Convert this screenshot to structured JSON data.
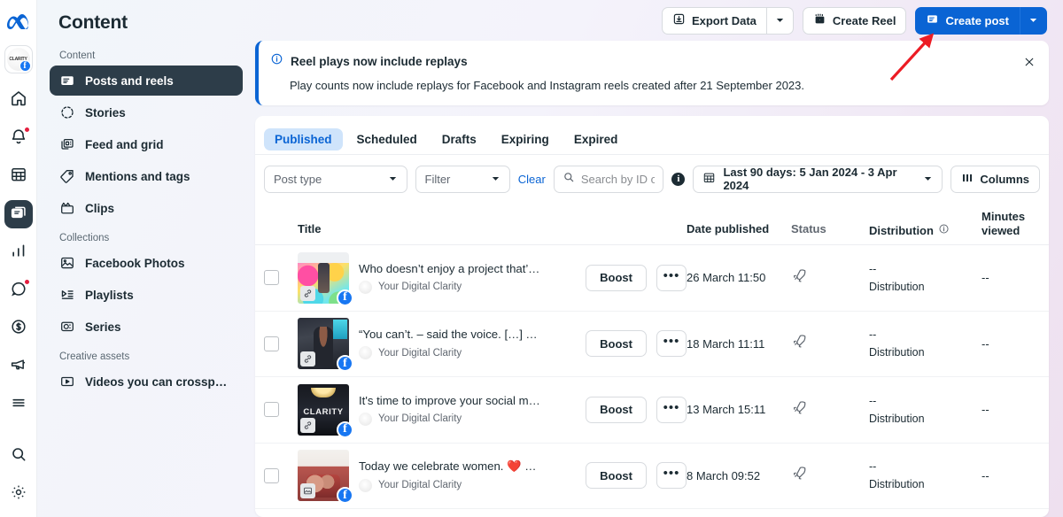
{
  "rail": {
    "logo": "meta-logo",
    "avatar_label": "CLARITY",
    "items": [
      {
        "name": "home",
        "icon": "home-icon",
        "badge": false,
        "active": false
      },
      {
        "name": "notifications",
        "icon": "bell-icon",
        "badge": true,
        "active": false
      },
      {
        "name": "planner",
        "icon": "calendar-grid-icon",
        "badge": false,
        "active": false
      },
      {
        "name": "content",
        "icon": "content-posts-icon",
        "badge": false,
        "active": true
      },
      {
        "name": "insights",
        "icon": "bar-chart-icon",
        "badge": false,
        "active": false
      },
      {
        "name": "inbox",
        "icon": "chat-bubble-icon",
        "badge": true,
        "active": false
      },
      {
        "name": "monetisation",
        "icon": "dollar-coin-icon",
        "badge": false,
        "active": false
      },
      {
        "name": "ads",
        "icon": "megaphone-icon",
        "badge": false,
        "active": false
      },
      {
        "name": "all-tools",
        "icon": "hamburger-icon",
        "badge": false,
        "active": false
      }
    ],
    "bottom": [
      {
        "name": "search",
        "icon": "search-icon"
      },
      {
        "name": "settings",
        "icon": "gear-icon"
      }
    ]
  },
  "nav": {
    "title": "Content",
    "groups": [
      {
        "label": "Content",
        "items": [
          {
            "label": "Posts and reels",
            "icon": "posts-reels-icon",
            "active": true
          },
          {
            "label": "Stories",
            "icon": "stories-ring-icon",
            "active": false
          },
          {
            "label": "Feed and grid",
            "icon": "feed-grid-icon",
            "active": false
          },
          {
            "label": "Mentions and tags",
            "icon": "tag-icon",
            "active": false
          },
          {
            "label": "Clips",
            "icon": "clapperboard-icon",
            "active": false
          }
        ]
      },
      {
        "label": "Collections",
        "items": [
          {
            "label": "Facebook Photos",
            "icon": "photo-icon",
            "active": false
          },
          {
            "label": "Playlists",
            "icon": "playlist-icon",
            "active": false
          },
          {
            "label": "Series",
            "icon": "series-icon",
            "active": false
          }
        ]
      },
      {
        "label": "Creative assets",
        "items": [
          {
            "label": "Videos you can crossp…",
            "icon": "video-play-icon",
            "active": false
          }
        ]
      }
    ]
  },
  "toolbar": {
    "export_label": "Export Data",
    "export_icon": "download-box-icon",
    "export_caret": "caret-down-icon",
    "create_reel_label": "Create Reel",
    "create_reel_icon": "reel-clapper-icon",
    "create_post_label": "Create post",
    "create_post_icon": "post-card-icon",
    "create_post_caret": "caret-down-icon"
  },
  "banner": {
    "icon": "info-circle-icon",
    "title": "Reel plays now include replays",
    "body": "Play counts now include replays for Facebook and Instagram reels created after 21 September 2023.",
    "close_icon": "close-icon",
    "accent": "#0a64d4"
  },
  "tabs": [
    {
      "label": "Published",
      "active": true
    },
    {
      "label": "Scheduled",
      "active": false
    },
    {
      "label": "Drafts",
      "active": false
    },
    {
      "label": "Expiring",
      "active": false
    },
    {
      "label": "Expired",
      "active": false
    }
  ],
  "filters": {
    "post_type_label": "Post type",
    "filter_label": "Filter",
    "clear_label": "Clear",
    "search_placeholder": "Search by ID or",
    "search_value": "",
    "search_icon": "search-icon",
    "search_info_icon": "info-icon",
    "date_range_label": "Last 90 days: 5 Jan 2024 - 3 Apr 2024",
    "date_icon": "calendar-icon",
    "columns_label": "Columns",
    "columns_icon": "columns-icon"
  },
  "table": {
    "headers": {
      "title": "Title",
      "date_published": "Date published",
      "status": "Status",
      "distribution": "Distribution",
      "distribution_info_icon": "info-circle-icon",
      "minutes_viewed_line1": "Minutes",
      "minutes_viewed_line2": "viewed"
    },
    "boost_label": "Boost",
    "more_label": "•••",
    "rows": [
      {
        "title": "Who doesn’t enjoy a project that’s a…",
        "page": "Your Digital Clarity",
        "date": "26 March 11:50",
        "status_icon": "rocket-icon",
        "distribution_value": "--",
        "distribution_label": "Distribution",
        "minutes_viewed": "--",
        "platform_icon": "facebook-icon",
        "attachment_icon": "link-icon",
        "art": "art1"
      },
      {
        "title": "“You can’t. – said the voice. […] The…",
        "page": "Your Digital Clarity",
        "date": "18 March 11:11",
        "status_icon": "rocket-icon",
        "distribution_value": "--",
        "distribution_label": "Distribution",
        "minutes_viewed": "--",
        "platform_icon": "facebook-icon",
        "attachment_icon": "link-icon",
        "art": "art2"
      },
      {
        "title": "It's time to improve your social medi…",
        "page": "Your Digital Clarity",
        "date": "13 March 15:11",
        "status_icon": "rocket-icon",
        "distribution_value": "--",
        "distribution_label": "Distribution",
        "minutes_viewed": "--",
        "platform_icon": "facebook-icon",
        "attachment_icon": "link-icon",
        "art": "art3",
        "art_word": "CLARITY"
      },
      {
        "title": "Today we celebrate women. ❤️ Not …",
        "page": "Your Digital Clarity",
        "date": "8 March 09:52",
        "status_icon": "rocket-icon",
        "distribution_value": "--",
        "distribution_label": "Distribution",
        "minutes_viewed": "--",
        "platform_icon": "facebook-icon",
        "attachment_icon": "photo-icon",
        "art": "art4"
      }
    ]
  },
  "annotation": {
    "arrow_color": "#ec1c24",
    "name": "red-arrow-pointing-to-create-post"
  }
}
